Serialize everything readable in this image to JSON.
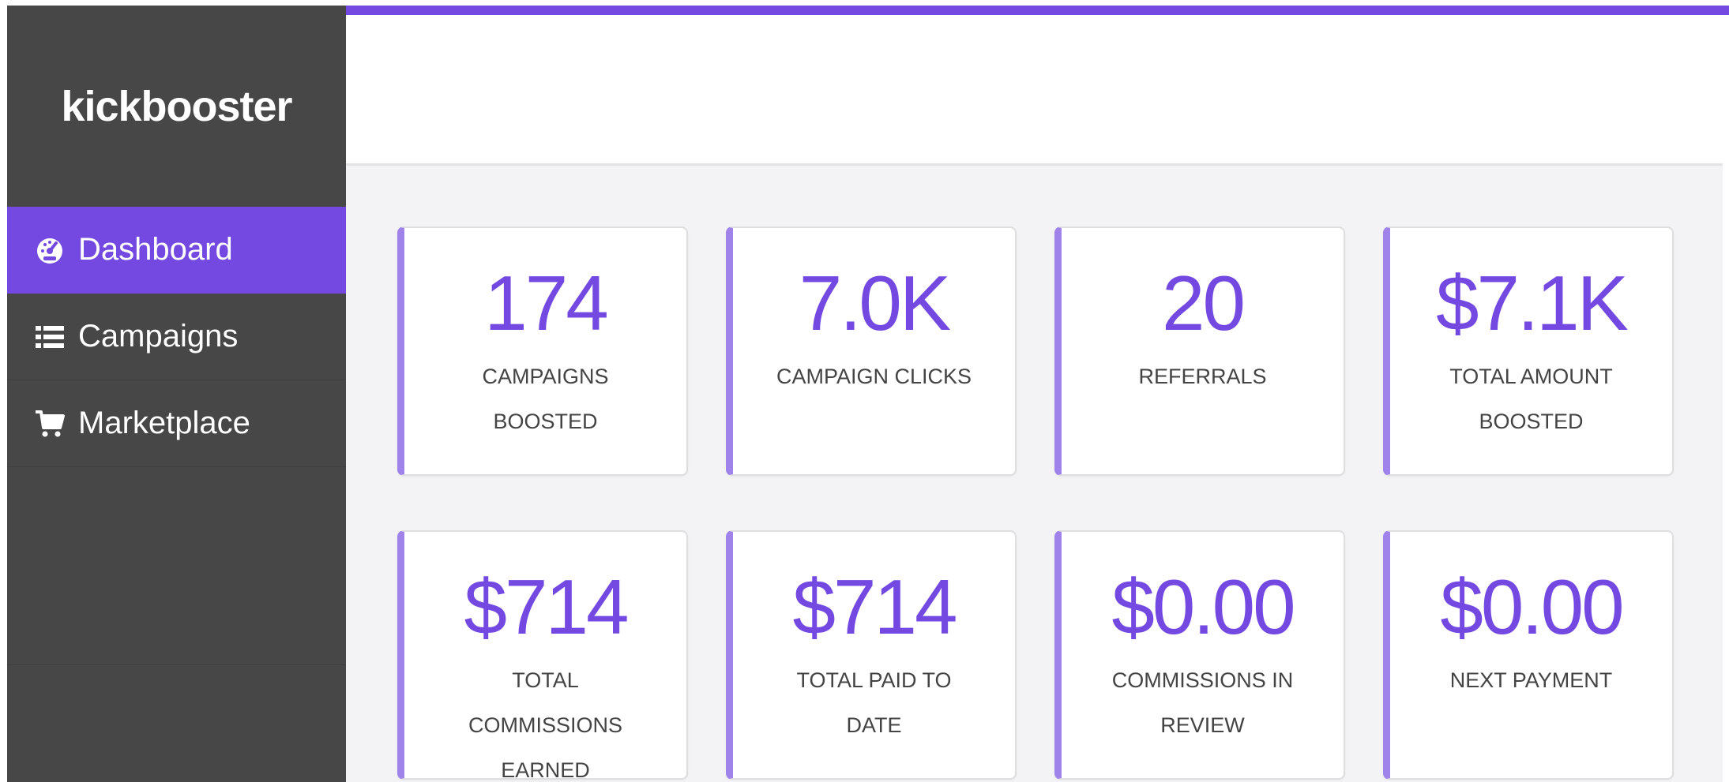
{
  "app": {
    "logo_text": "kickbooster"
  },
  "colors": {
    "accent": "#7349e1",
    "card_border_accent": "#9f83eb",
    "sidebar_bg": "#474747",
    "content_bg": "#f3f3f5"
  },
  "sidebar": {
    "items": [
      {
        "label": "Dashboard",
        "icon": "dashboard-gauge-icon",
        "active": true
      },
      {
        "label": "Campaigns",
        "icon": "list-icon",
        "active": false
      },
      {
        "label": "Marketplace",
        "icon": "shopping-cart-icon",
        "active": false
      }
    ]
  },
  "stats": [
    {
      "value": "174",
      "label": "CAMPAIGNS BOOSTED"
    },
    {
      "value": "7.0K",
      "label": "CAMPAIGN CLICKS"
    },
    {
      "value": "20",
      "label": "REFERRALS"
    },
    {
      "value": "$7.1K",
      "label": "TOTAL AMOUNT BOOSTED"
    },
    {
      "value": "$714",
      "label": "TOTAL COMMISSIONS EARNED"
    },
    {
      "value": "$714",
      "label": "TOTAL PAID TO DATE"
    },
    {
      "value": "$0.00",
      "label": "COMMISSIONS IN REVIEW"
    },
    {
      "value": "$0.00",
      "label": "NEXT PAYMENT"
    }
  ]
}
